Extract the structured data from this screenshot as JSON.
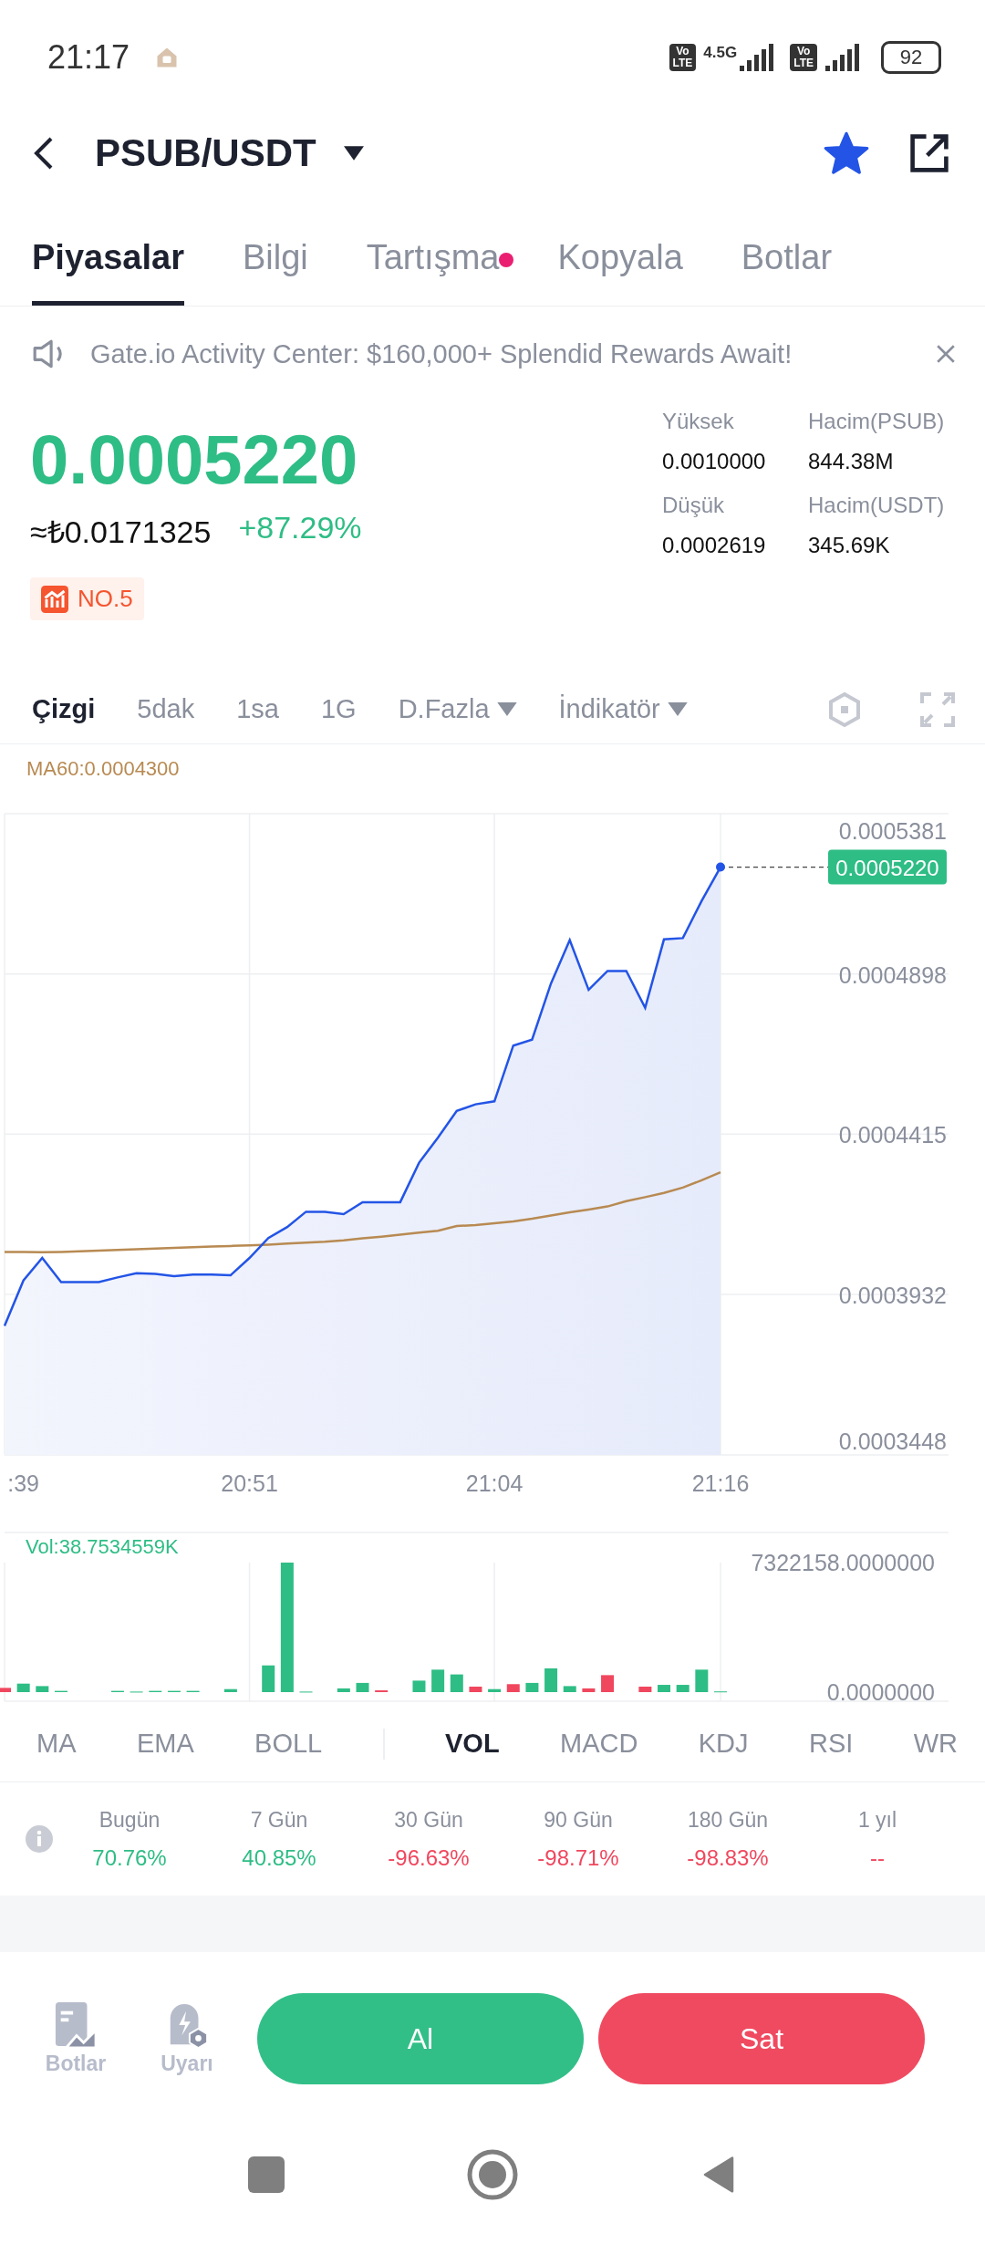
{
  "status_bar": {
    "time": "21:17",
    "network": "4.5G",
    "volte": [
      {
        "top": "Vo",
        "bottom": "LTE"
      },
      {
        "top": "Vo",
        "bottom": "LTE"
      }
    ],
    "battery": "92"
  },
  "header": {
    "pair": "PSUB/USDT",
    "favorite": true
  },
  "tabs": [
    {
      "label": "Piyasalar",
      "selected": true,
      "dot": false
    },
    {
      "label": "Bilgi",
      "selected": false,
      "dot": false
    },
    {
      "label": "Tartışma",
      "selected": false,
      "dot": true
    },
    {
      "label": "Kopyala",
      "selected": false,
      "dot": false
    },
    {
      "label": "Botlar",
      "selected": false,
      "dot": false
    }
  ],
  "banner": {
    "text": "Gate.io Activity Center: $160,000+ Splendid Rewards Await!"
  },
  "price": {
    "last": "0.0005220",
    "fiat": "≈₺0.0171325",
    "change": "+87.29%",
    "rank": "NO.5"
  },
  "stats": [
    {
      "label": "Yüksek",
      "value": "0.0010000"
    },
    {
      "label": "Hacim(PSUB)",
      "value": "844.38M"
    },
    {
      "label": "Düşük",
      "value": "0.0002619"
    },
    {
      "label": "Hacim(USDT)",
      "value": "345.69K"
    }
  ],
  "toolbar": [
    {
      "label": "Çizgi",
      "selected": true,
      "dropdown": false
    },
    {
      "label": "5dak",
      "selected": false,
      "dropdown": false
    },
    {
      "label": "1sa",
      "selected": false,
      "dropdown": false
    },
    {
      "label": "1G",
      "selected": false,
      "dropdown": false
    },
    {
      "label": "D.Fazla",
      "selected": false,
      "dropdown": true
    },
    {
      "label": "İndikatör",
      "selected": false,
      "dropdown": true
    }
  ],
  "chart": {
    "ma_label": "MA60:0.0004300",
    "price_tag": "0.0005220",
    "chart_data": {
      "type": "line",
      "grid": true,
      "categories": [
        null,
        ":39",
        null,
        null,
        null,
        null,
        null,
        null,
        null,
        null,
        null,
        null,
        null,
        "20:51",
        null,
        null,
        null,
        null,
        null,
        null,
        null,
        null,
        null,
        null,
        null,
        null,
        "21:04",
        null,
        null,
        null,
        null,
        null,
        null,
        null,
        null,
        null,
        null,
        null,
        "21:16"
      ],
      "ylim": [
        0.0003448,
        0.0005381
      ],
      "yticks": [
        0.0003448,
        0.0003932,
        0.0004415,
        0.0004898,
        0.0005381
      ],
      "series": [
        {
          "type": "area",
          "color": "#2354e6",
          "values": [
            0.0003837,
            0.0003974,
            0.0004042,
            0.0003969,
            0.0003969,
            0.0003969,
            0.0003983,
            0.0003996,
            0.0003994,
            0.0003987,
            0.0003992,
            0.0003992,
            0.000399,
            0.0004042,
            0.0004102,
            0.0004135,
            0.0004181,
            0.0004181,
            0.0004174,
            0.000421,
            0.000421,
            0.000421,
            0.0004329,
            0.0004404,
            0.0004485,
            0.0004505,
            0.0004514,
            0.0004682,
            0.00047,
            0.0004869,
            0.0005,
            0.000485,
            0.0004907,
            0.0004907,
            0.0004796,
            0.0005002,
            0.0005006,
            0.0005118,
            0.000522
          ]
        },
        {
          "type": "line",
          "color": "#b88a52",
          "values": [
            0.000406,
            0.000406,
            0.0004059,
            0.000406,
            0.0004062,
            0.0004064,
            0.0004066,
            0.0004068,
            0.000407,
            0.0004072,
            0.0004074,
            0.0004076,
            0.0004078,
            0.000408,
            0.0004082,
            0.0004085,
            0.0004088,
            0.0004091,
            0.0004095,
            0.0004101,
            0.0004106,
            0.0004112,
            0.0004118,
            0.0004124,
            0.0004138,
            0.0004141,
            0.0004146,
            0.0004152,
            0.000416,
            0.000417,
            0.0004179,
            0.0004188,
            0.0004197,
            0.0004213,
            0.0004225,
            0.0004238,
            0.0004254,
            0.0004276,
            0.00043
          ]
        }
      ]
    }
  },
  "volume": {
    "label": "Vol:38.7534559K",
    "chart_data": {
      "type": "bar",
      "stacked": true,
      "grid": true,
      "categories": [
        null,
        null,
        null,
        null,
        null,
        null,
        null,
        null,
        null,
        null,
        null,
        null,
        null,
        null,
        null,
        null,
        null,
        null,
        null,
        null,
        null,
        null,
        null,
        null,
        null,
        null,
        null,
        null,
        null,
        null,
        null,
        null,
        null,
        null,
        null,
        null,
        null,
        null,
        null
      ],
      "ylim": [
        0,
        7322158
      ],
      "yticks": [
        {
          "value": 0,
          "label": "0.0000000"
        },
        {
          "value": 7322158,
          "label": "7322158.0000000"
        }
      ],
      "series": [
        {
          "color": "#2ebd85",
          "values": [
            null,
            480000,
            340000,
            70000,
            null,
            null,
            70000,
            30000,
            70000,
            70000,
            70000,
            null,
            170000,
            null,
            1510000,
            7322158,
            30000,
            null,
            210000,
            520000,
            null,
            null,
            650000,
            1270000,
            1000000,
            null,
            170000,
            null,
            520000,
            1340000,
            340000,
            null,
            null,
            null,
            null,
            410000,
            410000,
            1270000,
            40000
          ]
        },
        {
          "color": "#f0475e",
          "values": [
            240000,
            null,
            null,
            null,
            null,
            null,
            null,
            null,
            null,
            null,
            null,
            null,
            null,
            null,
            null,
            null,
            null,
            null,
            null,
            null,
            100000,
            null,
            null,
            null,
            null,
            310000,
            null,
            450000,
            null,
            null,
            null,
            210000,
            960000,
            null,
            310000,
            null,
            null,
            null,
            null
          ]
        }
      ]
    }
  },
  "indicators": [
    {
      "label": "MA",
      "selected": false,
      "divider_before": false
    },
    {
      "label": "EMA",
      "selected": false,
      "divider_before": false
    },
    {
      "label": "BOLL",
      "selected": false,
      "divider_before": false
    },
    {
      "label": "VOL",
      "selected": true,
      "divider_before": true
    },
    {
      "label": "MACD",
      "selected": false,
      "divider_before": false
    },
    {
      "label": "KDJ",
      "selected": false,
      "divider_before": false
    },
    {
      "label": "RSI",
      "selected": false,
      "divider_before": false
    },
    {
      "label": "WR",
      "selected": false,
      "divider_before": false
    }
  ],
  "performance": [
    {
      "label": "Bugün",
      "value": "70.76%",
      "color": "#2ebd85"
    },
    {
      "label": "7 Gün",
      "value": "40.85%",
      "color": "#2ebd85"
    },
    {
      "label": "30 Gün",
      "value": "-96.63%",
      "color": "#f0475e"
    },
    {
      "label": "90 Gün",
      "value": "-98.71%",
      "color": "#f0475e"
    },
    {
      "label": "180 Gün",
      "value": "-98.83%",
      "color": "#f0475e"
    },
    {
      "label": "1 yıl",
      "value": "--",
      "color": "#f0475e"
    }
  ],
  "actions": {
    "shortcuts": [
      {
        "label": "Botlar",
        "kind": "bots"
      },
      {
        "label": "Uyarı",
        "kind": "alert"
      }
    ],
    "buy": "Al",
    "sell": "Sat"
  }
}
